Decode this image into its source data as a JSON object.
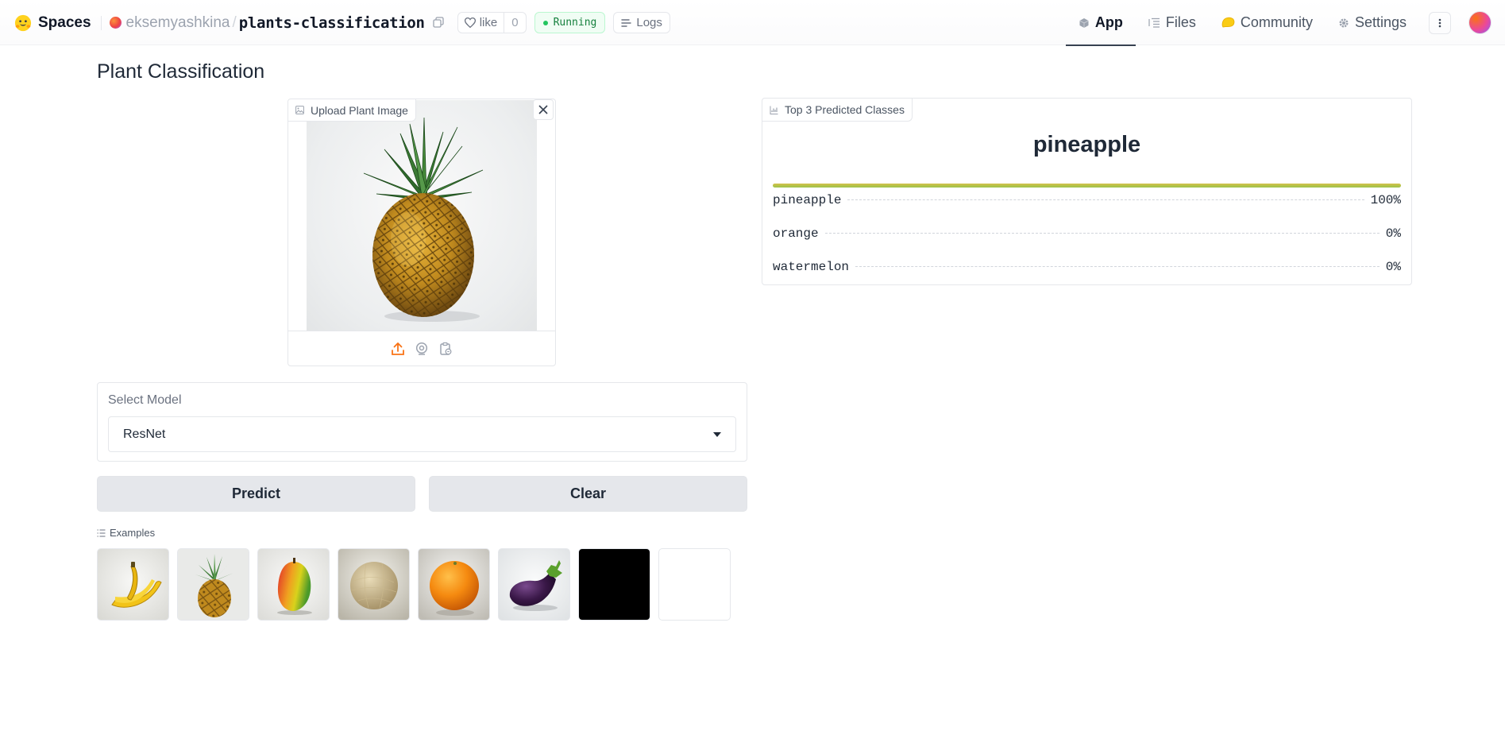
{
  "header": {
    "brand": "Spaces",
    "owner": "eksemyashkina",
    "separator": "/",
    "repo": "plants-classification",
    "like_label": "like",
    "like_count": "0",
    "status": "Running",
    "logs_label": "Logs",
    "tabs": [
      {
        "label": "App",
        "icon": "cube-icon",
        "active": true
      },
      {
        "label": "Files",
        "icon": "files-icon",
        "active": false
      },
      {
        "label": "Community",
        "icon": "community-icon",
        "active": false
      },
      {
        "label": "Settings",
        "icon": "gear-icon",
        "active": false
      }
    ]
  },
  "main": {
    "title": "Plant Classification",
    "upload": {
      "label": "Upload Plant Image",
      "image": "pineapple"
    },
    "results": {
      "label": "Top 3 Predicted Classes",
      "top_class": "pineapple",
      "items": [
        {
          "label": "pineapple",
          "value": "100%",
          "fraction": 1.0
        },
        {
          "label": "orange",
          "value": "0%",
          "fraction": 0
        },
        {
          "label": "watermelon",
          "value": "0%",
          "fraction": 0
        }
      ]
    },
    "model": {
      "label": "Select Model",
      "value": "ResNet"
    },
    "buttons": {
      "predict": "Predict",
      "clear": "Clear"
    },
    "examples": {
      "label": "Examples",
      "items": [
        "banana",
        "pineapple",
        "mango",
        "melon",
        "orange",
        "eggplant",
        "black",
        "white"
      ]
    }
  },
  "colors": {
    "accent_orange": "#f97316",
    "running_green": "#22c55e",
    "confidence_bar": "#a3c14a",
    "button_bg": "#e5e7eb"
  }
}
